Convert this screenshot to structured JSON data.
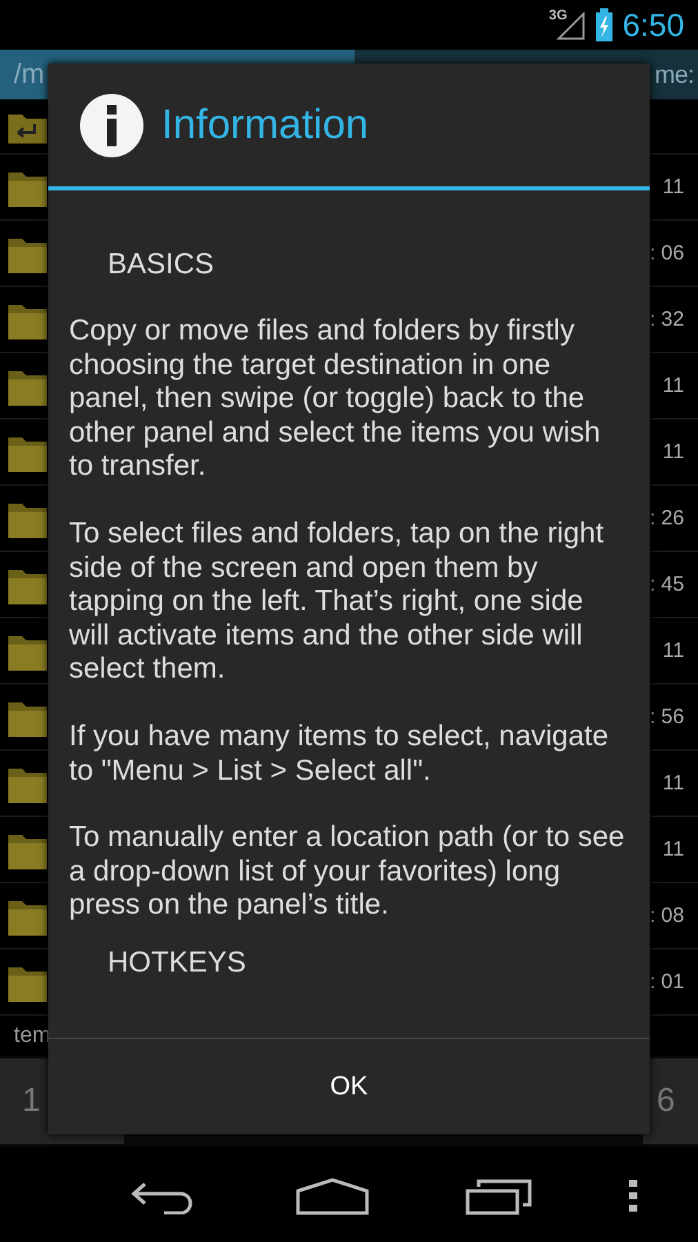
{
  "status_bar": {
    "network": "3G",
    "time": "6:50"
  },
  "panel_header": {
    "left_path": "/m",
    "right_label": "me:",
    "left_selected": true
  },
  "file_rows": [
    {
      "kind": "up"
    },
    {
      "kind": "folder",
      "time": "11"
    },
    {
      "kind": "folder",
      "time": ": 06"
    },
    {
      "kind": "folder",
      "time": ": 32"
    },
    {
      "kind": "folder",
      "time": "11"
    },
    {
      "kind": "folder",
      "time": "11"
    },
    {
      "kind": "folder",
      "time": ": 26"
    },
    {
      "kind": "folder",
      "time": ": 45"
    },
    {
      "kind": "folder",
      "time": "11"
    },
    {
      "kind": "folder",
      "time": ": 56"
    },
    {
      "kind": "folder",
      "time": "11"
    },
    {
      "kind": "folder",
      "time": "11"
    },
    {
      "kind": "folder",
      "time": ": 08"
    },
    {
      "kind": "folder",
      "time": ": 01"
    }
  ],
  "panel_footer": "tem",
  "bottom_buttons": [
    "1",
    "6"
  ],
  "dialog": {
    "title": "Information",
    "sections": [
      {
        "kind": "heading",
        "text": "BASICS"
      },
      {
        "kind": "paragraph",
        "text": "Copy or move files and folders by firstly choosing the target destination in one panel, then swipe (or toggle) back to the other panel and select the items you wish to transfer."
      },
      {
        "kind": "paragraph",
        "text": "To select files and folders, tap on the right side of the screen and open them by tapping on the left. That’s right, one side will activate items and the other side will select them."
      },
      {
        "kind": "paragraph",
        "text": "If you have many items to select, navigate to \"Menu > List > Select all\"."
      },
      {
        "kind": "paragraph",
        "text": "To manually enter a location path (or to see a drop-down list of your favorites) long press on the panel’s title."
      },
      {
        "kind": "heading",
        "text": "HOTKEYS"
      }
    ],
    "button": "OK"
  }
}
